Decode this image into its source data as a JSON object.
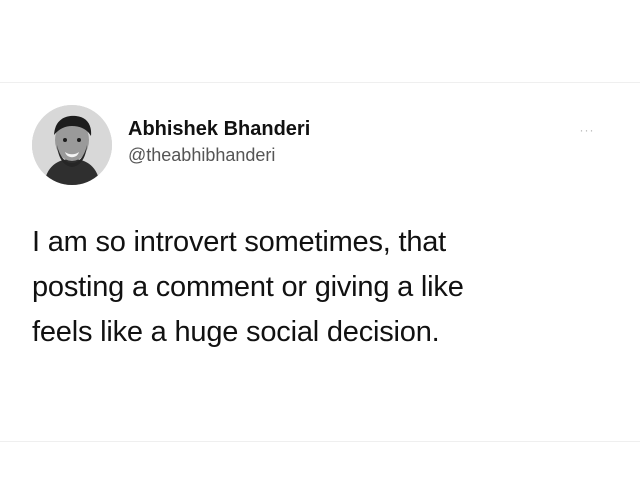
{
  "tweet": {
    "author": {
      "display_name": "Abhishek Bhanderi",
      "handle": "@theabhibhanderi",
      "avatar": "profile-photo"
    },
    "more_icon": "ellipsis-icon",
    "more_label": "···",
    "text_lines": [
      "I am so introvert sometimes, that",
      "posting a comment or giving a like",
      "feels like a huge social decision."
    ]
  },
  "colors": {
    "background": "#ffffff",
    "text": "#111111",
    "handle": "#555555",
    "icon": "#b6b6b6"
  }
}
